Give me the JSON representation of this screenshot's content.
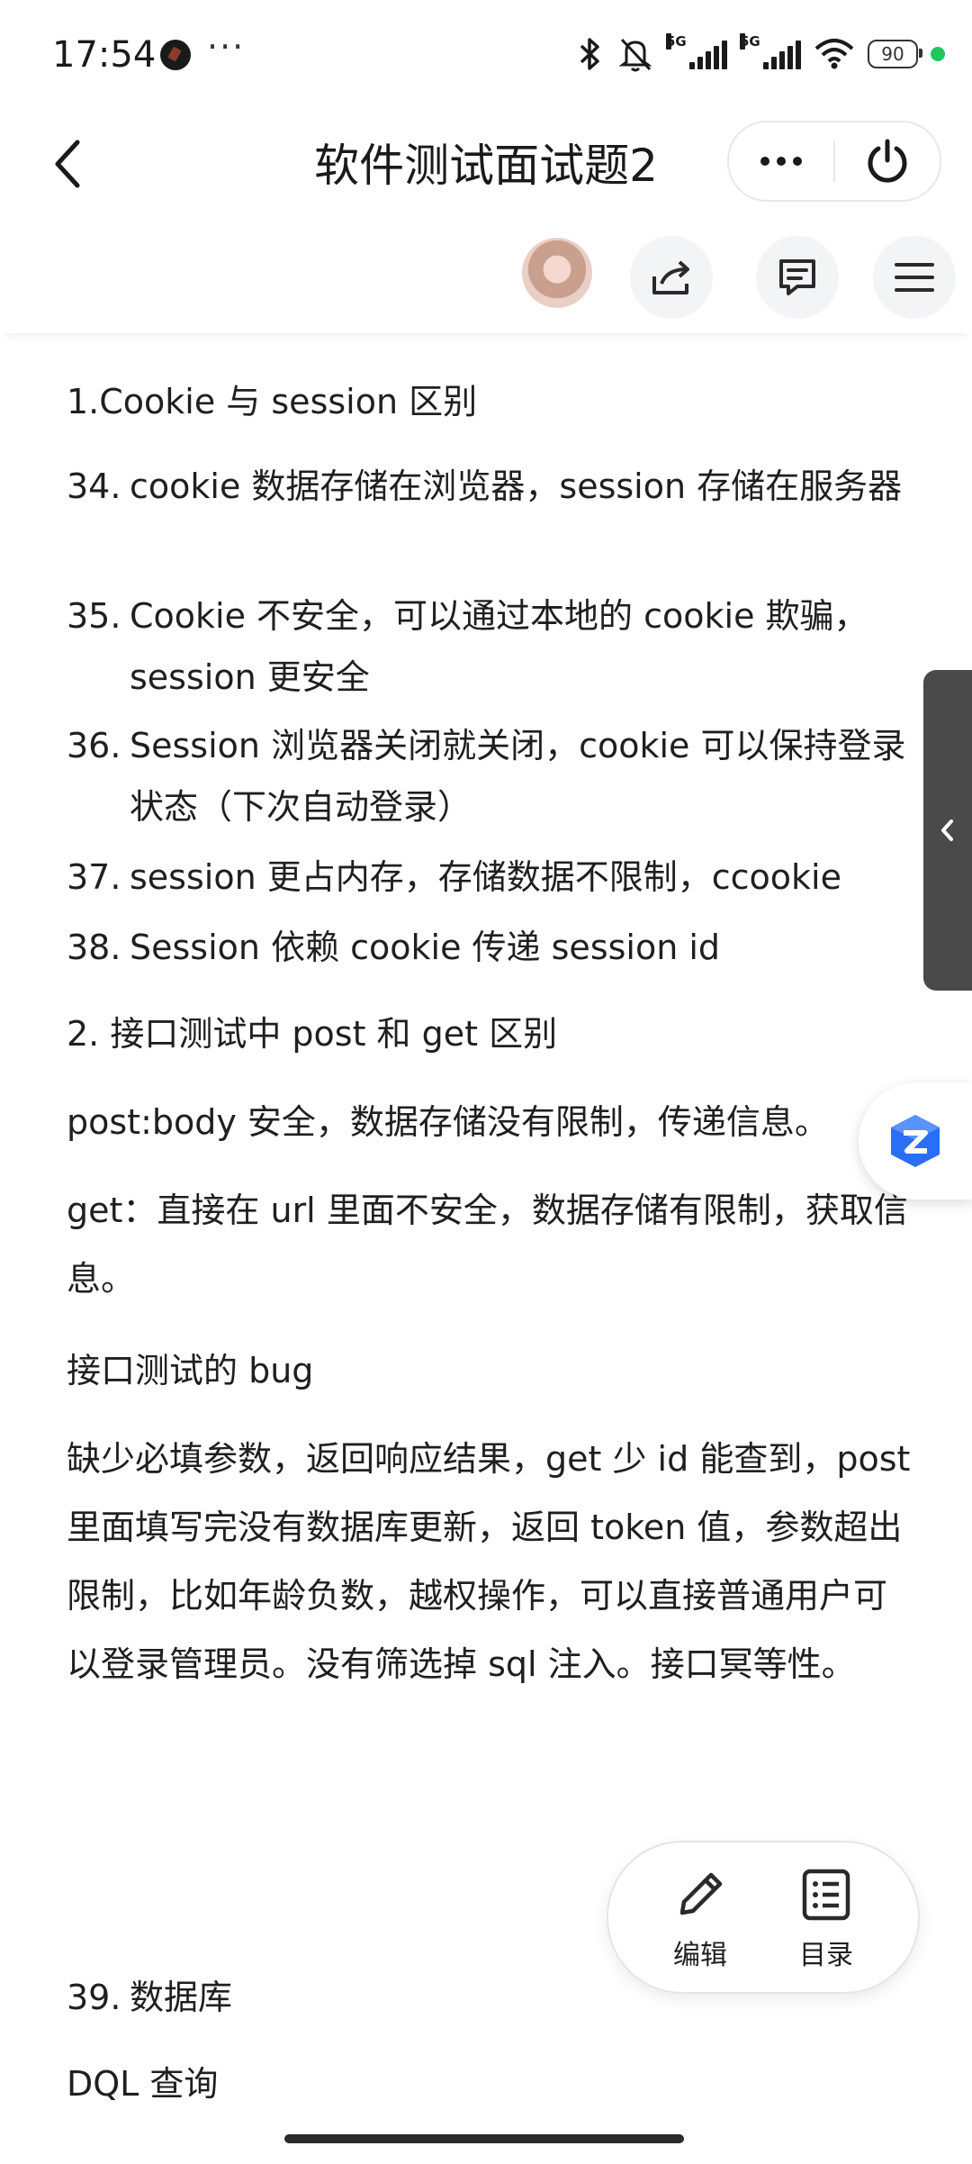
{
  "status_bar": {
    "time": "17:54",
    "more": "···",
    "network_tag_1": "5G",
    "network_tag_2": "5G",
    "battery": "90"
  },
  "header": {
    "title": "软件测试面试题2"
  },
  "toolbar": {
    "icons": [
      "avatar",
      "share-icon",
      "comment-icon",
      "menu-icon"
    ]
  },
  "document": {
    "section1_heading": "1.Cookie 与 session 区别",
    "list1": [
      {
        "num": "34.",
        "text": "cookie 数据存储在浏览器，session 存储在服务器"
      },
      {
        "num": "35.",
        "text": "Cookie 不安全，可以通过本地的 cookie 欺骗，session 更安全"
      },
      {
        "num": "36.",
        "text": "Session 浏览器关闭就关闭，cookie 可以保持登录状态（下次自动登录）"
      },
      {
        "num": "37.",
        "text": "session 更占内存，存储数据不限制，ccookie"
      },
      {
        "num": "38.",
        "text": "Session 依赖 cookie 传递 session id"
      }
    ],
    "section2_heading": "2. 接口测试中 post 和 get 区别",
    "post_text": "post:body 安全，数据存储没有限制，传递信息。",
    "get_text": "get：直接在 url 里面不安全，数据存储有限制，获取信息。",
    "bug_heading": "接口测试的 bug",
    "bug_text": "缺少必填参数，返回响应结果，get 少 id 能查到，post 里面填写完没有数据库更新，返回 token 值，参数超出限制，比如年龄负数，越权操作，可以直接普通用户可以登录管理员。没有筛选掉 sql 注入。接口冥等性。",
    "list2": [
      {
        "num": "39.",
        "text": "数据库"
      }
    ],
    "dql_text": "DQL 查询"
  },
  "fab": {
    "edit_label": "编辑",
    "toc_label": "目录"
  },
  "colors": {
    "accent_ai": "#2b6ef6",
    "side_tab": "#4a4a4a",
    "status_dot": "#22c55e"
  }
}
